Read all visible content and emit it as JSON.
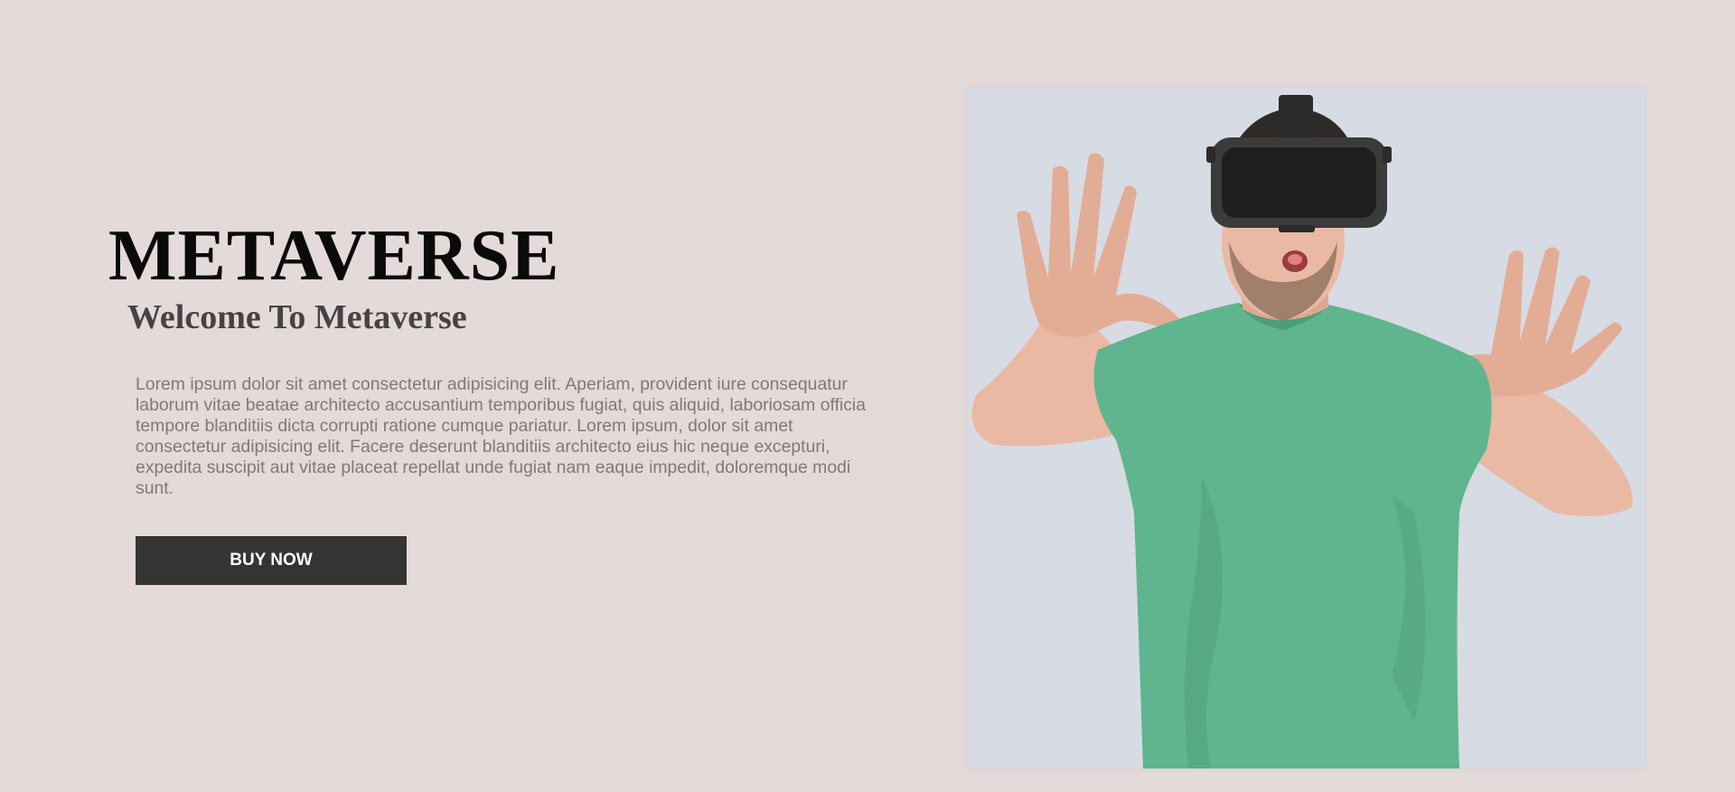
{
  "hero": {
    "title": "METAVERSE",
    "subtitle": "Welcome To Metaverse",
    "paragraph": "Lorem ipsum dolor sit amet consectetur adipisicing elit. Aperiam, provident iure consequatur laborum vitae beatae architecto accusantium temporibus fugiat, quis aliquid, laboriosam officia tempore blanditiis dicta corrupti ratione cumque pariatur. Lorem ipsum, dolor sit amet consectetur adipisicing elit. Facere deserunt blanditiis architecto eius hic neque excepturi, expedita suscipit aut vitae placeat repellat unde fugiat nam eaque impedit, doloremque modi sunt.",
    "button_label": "BUY NOW",
    "image_icon": "vr-headset-person-photo"
  },
  "colors": {
    "page_background": "#e3dad9",
    "title": "#0a0a0a",
    "subtitle": "#454343",
    "paragraph": "#7e7a7a",
    "button_background": "#363433",
    "button_text": "#ffffff",
    "image_background": "#d7dbe4",
    "shirt": "#5fb58d",
    "skin": "#e9b9a4",
    "headset": "#2b2b2b"
  }
}
